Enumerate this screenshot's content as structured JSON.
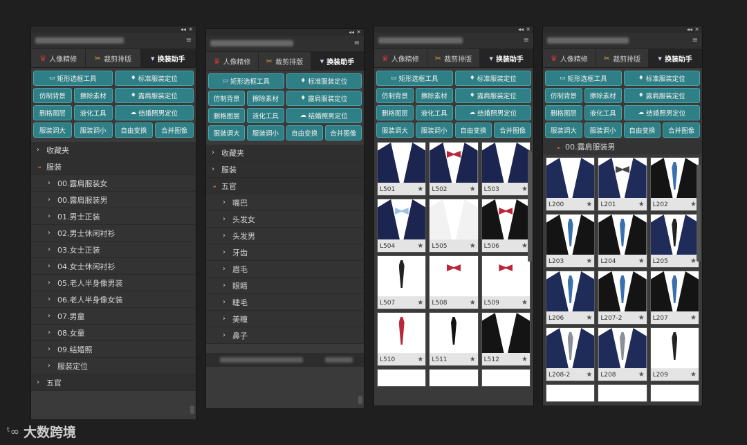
{
  "tabs": [
    {
      "label": "人像精修",
      "icon": "lipstick-icon"
    },
    {
      "label": "裁剪排版",
      "icon": "scissors-icon"
    },
    {
      "label": "换装助手",
      "icon": "tie-icon"
    }
  ],
  "buttons": {
    "rect_tool": "矩形选框工具",
    "std_pos": "标准服装定位",
    "imitate_bg": "仿制背景",
    "erase": "擦除素材",
    "shoulder_pos": "露肩服装定位",
    "delete_layer": "删格图层",
    "liquify": "液化工具",
    "wedding_pos": "结婚照男定位",
    "bigger": "服装调大",
    "smaller": "服装调小",
    "free_transform": "自由变换",
    "merge": "合并图像"
  },
  "panel1": {
    "tree": [
      {
        "label": "收藏夹",
        "level": 0,
        "open": false
      },
      {
        "label": "服装",
        "level": 0,
        "open": true
      },
      {
        "label": "00.露肩服装女",
        "level": 1
      },
      {
        "label": "00.露肩服装男",
        "level": 1
      },
      {
        "label": "01.男士正装",
        "level": 1
      },
      {
        "label": "02.男士休闲衬衫",
        "level": 1
      },
      {
        "label": "03.女士正装",
        "level": 1
      },
      {
        "label": "04.女士休闲衬衫",
        "level": 1
      },
      {
        "label": "05.老人半身像男装",
        "level": 1
      },
      {
        "label": "06.老人半身像女装",
        "level": 1
      },
      {
        "label": "07.男童",
        "level": 1
      },
      {
        "label": "08.女童",
        "level": 1
      },
      {
        "label": "09.结婚照",
        "level": 1
      },
      {
        "label": "服装定位",
        "level": 1
      },
      {
        "label": "五官",
        "level": 0,
        "open": false
      }
    ]
  },
  "panel2": {
    "tree": [
      {
        "label": "收藏夹",
        "level": 0,
        "open": false
      },
      {
        "label": "服装",
        "level": 0,
        "open": false
      },
      {
        "label": "五官",
        "level": 0,
        "open": true
      },
      {
        "label": "嘴巴",
        "level": 1
      },
      {
        "label": "头发女",
        "level": 1
      },
      {
        "label": "头发男",
        "level": 1
      },
      {
        "label": "牙齿",
        "level": 1
      },
      {
        "label": "眉毛",
        "level": 1
      },
      {
        "label": "眼睛",
        "level": 1
      },
      {
        "label": "睫毛",
        "level": 1
      },
      {
        "label": "美瞳",
        "level": 1
      },
      {
        "label": "鼻子",
        "level": 1
      }
    ]
  },
  "panel3": {
    "items": [
      {
        "label": "L501",
        "style": "vest-navy"
      },
      {
        "label": "L502",
        "style": "vest-navy-bow"
      },
      {
        "label": "L503",
        "style": "vest-navy"
      },
      {
        "label": "L504",
        "style": "vest-navy-bow-blue"
      },
      {
        "label": "L505",
        "style": "vest-white"
      },
      {
        "label": "L506",
        "style": "jacket-black-bow-red"
      },
      {
        "label": "L507",
        "style": "shirt-black-tie"
      },
      {
        "label": "L508",
        "style": "shirt-red-bow"
      },
      {
        "label": "L509",
        "style": "shirt-red-bow"
      },
      {
        "label": "L510",
        "style": "shirt-red-ribbon"
      },
      {
        "label": "L511",
        "style": "shirt-black-ribbon"
      },
      {
        "label": "L512",
        "style": "jacket-black"
      }
    ]
  },
  "panel4": {
    "section": "00.露肩服装男",
    "items": [
      {
        "label": "L200",
        "style": "suit-navy"
      },
      {
        "label": "L201",
        "style": "suit-navy-bow"
      },
      {
        "label": "L202",
        "style": "suit-black-blue-tie"
      },
      {
        "label": "L203",
        "style": "suit-black-blue-tie"
      },
      {
        "label": "L204",
        "style": "suit-black-blue-tie"
      },
      {
        "label": "L205",
        "style": "suit-navy-dark-tie"
      },
      {
        "label": "L206",
        "style": "suit-navy-blue-tie"
      },
      {
        "label": "L207-2",
        "style": "suit-black-blue-tie"
      },
      {
        "label": "L207",
        "style": "suit-black-blue-tie"
      },
      {
        "label": "L208-2",
        "style": "suit-navy-gray-tie"
      },
      {
        "label": "L208",
        "style": "suit-navy-gray-tie"
      },
      {
        "label": "L209",
        "style": "shirt-dark-tie"
      }
    ]
  },
  "watermark": {
    "logo": "ᵗ∞",
    "text": "大数跨境"
  },
  "colors": {
    "button": "#2e7f86",
    "button_border": "#4aa5ab",
    "panel": "#3a3a3a",
    "open_caret": "#e0a030"
  }
}
